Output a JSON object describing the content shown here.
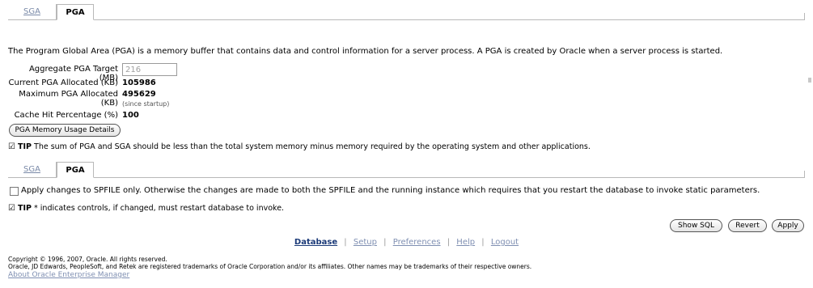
{
  "tabs_top": {
    "items": [
      {
        "label": "SGA",
        "active": false
      },
      {
        "label": "PGA",
        "active": true
      }
    ]
  },
  "description": "The Program Global Area (PGA) is a memory buffer that contains data and control information for a server process. A PGA is created by Oracle when a server process is started.",
  "form": {
    "aggregate_target_label": "Aggregate PGA Target (MB)",
    "aggregate_target_value": "216",
    "current_allocated_label": "Current PGA Allocated (KB)",
    "current_allocated_value": "105986",
    "max_allocated_label": "Maximum PGA Allocated (KB)",
    "max_allocated_value": "495629",
    "max_allocated_note": "(since startup)",
    "cache_hit_label": "Cache Hit Percentage (%)",
    "cache_hit_value": "100"
  },
  "buttons": {
    "memory_usage_details": "PGA Memory Usage Details",
    "show_sql": "Show SQL",
    "revert": "Revert",
    "apply": "Apply"
  },
  "tip1": {
    "label": "TIP",
    "text": "The sum of PGA and SGA should be less than the total system memory minus memory required by the operating system and other applications."
  },
  "tabs_bottom": {
    "items": [
      {
        "label": "SGA",
        "active": false
      },
      {
        "label": "PGA",
        "active": true
      }
    ]
  },
  "spfile_checkbox": {
    "checked": false,
    "label": "Apply changes to SPFILE only. Otherwise the changes are made to both the SPFILE and the running instance which requires that you restart the database to invoke static parameters."
  },
  "tip2": {
    "label": "TIP",
    "text": "* indicates controls, if changed, must restart database to invoke."
  },
  "footer": {
    "links": [
      {
        "label": "Database",
        "active": true
      },
      {
        "label": "Setup",
        "active": false
      },
      {
        "label": "Preferences",
        "active": false
      },
      {
        "label": "Help",
        "active": false
      },
      {
        "label": "Logout",
        "active": false
      }
    ],
    "separator": "|",
    "copyright": "Copyright © 1996, 2007, Oracle. All rights reserved.",
    "trademark": "Oracle, JD Edwards, PeopleSoft, and Retek are registered trademarks of Oracle Corporation and/or its affiliates. Other names may be trademarks of their respective owners.",
    "about_link": "About Oracle Enterprise Manager"
  },
  "icons": {
    "tip_icon": "check-icon"
  }
}
